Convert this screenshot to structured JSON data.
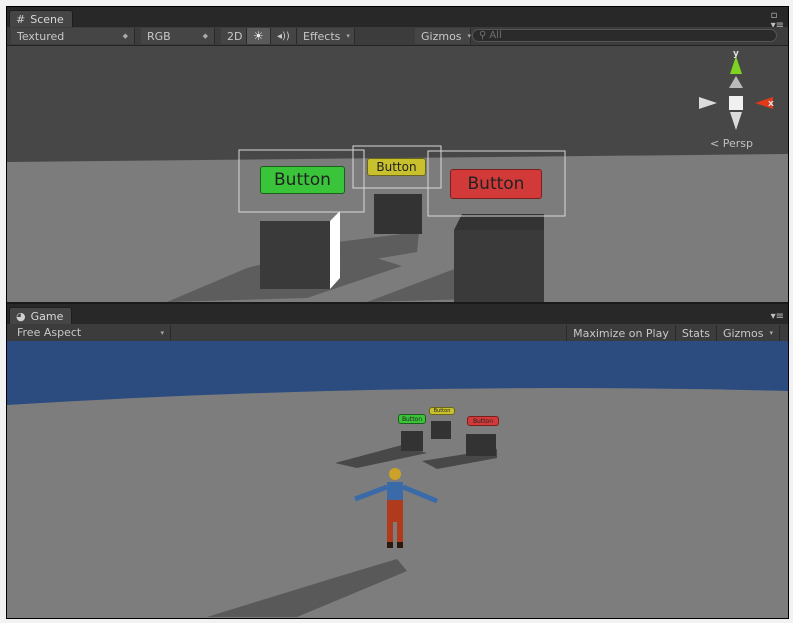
{
  "scene_tab": {
    "label": "Scene",
    "icon": "grid-icon"
  },
  "scene_toolbar": {
    "render_mode": "Textured",
    "color_mode": "RGB",
    "toggle_2d": "2D",
    "lighting_icon": "sun-icon",
    "audio_icon": "speaker-icon",
    "effects": "Effects",
    "gizmos": "Gizmos",
    "search_placeholder": "All"
  },
  "scene_gizmo": {
    "y_label": "y",
    "x_label": "x",
    "projection": "Persp"
  },
  "scene_buttons": [
    {
      "label": "Button",
      "color": "#3ac43a"
    },
    {
      "label": "Button",
      "color": "#c9c02e"
    },
    {
      "label": "Button",
      "color": "#d23a3a"
    }
  ],
  "game_tab": {
    "label": "Game",
    "icon": "pacman-icon"
  },
  "game_toolbar": {
    "aspect": "Free Aspect",
    "maximize": "Maximize on Play",
    "stats": "Stats",
    "gizmos": "Gizmos"
  },
  "game_buttons": [
    {
      "label": "Button",
      "color": "#3ac43a"
    },
    {
      "label": "Button",
      "color": "#c9c02e"
    },
    {
      "label": "Button",
      "color": "#d23a3a"
    }
  ],
  "colors": {
    "sky": "#2c4c7f",
    "ground": "#7d7d7d",
    "scene_bg": "#474747"
  }
}
